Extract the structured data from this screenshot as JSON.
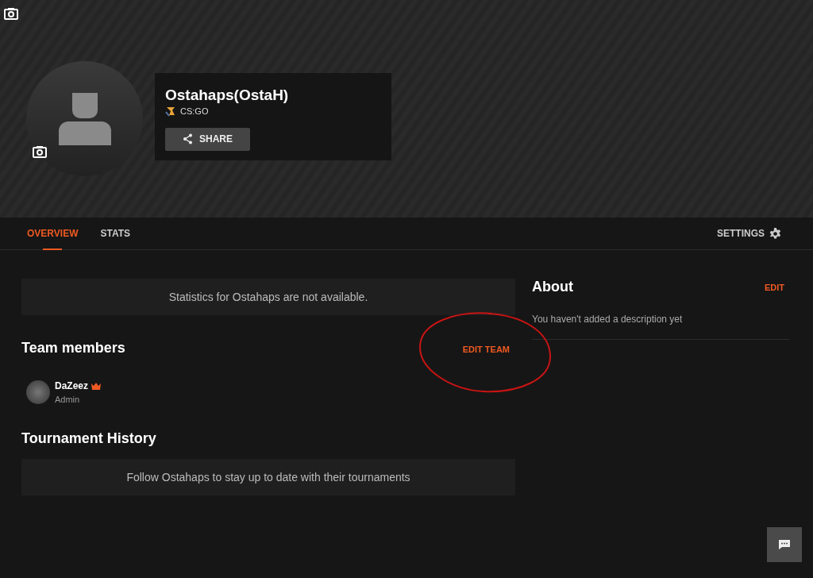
{
  "banner": {
    "profile_name": "Ostahaps(OstaH)",
    "game": "CS:GO",
    "share_button": "SHARE"
  },
  "tabs": [
    {
      "label": "OVERVIEW",
      "selected": true
    },
    {
      "label": "STATS",
      "selected": false
    }
  ],
  "settings": "SETTINGS",
  "stats_notice": "Statistics for Ostahaps are not available.",
  "team": {
    "title": "Team members",
    "edit": "EDIT TEAM",
    "edit_circled": true,
    "members": [
      {
        "name": "DaZeez",
        "role": "Admin",
        "owner": true
      }
    ]
  },
  "tournament_history": {
    "title": "Tournament History",
    "notice": "Follow Ostahaps to stay up to date with their tournaments"
  },
  "about": {
    "title": "About",
    "edit": "EDIT",
    "description": "You haven't added a description yet"
  }
}
